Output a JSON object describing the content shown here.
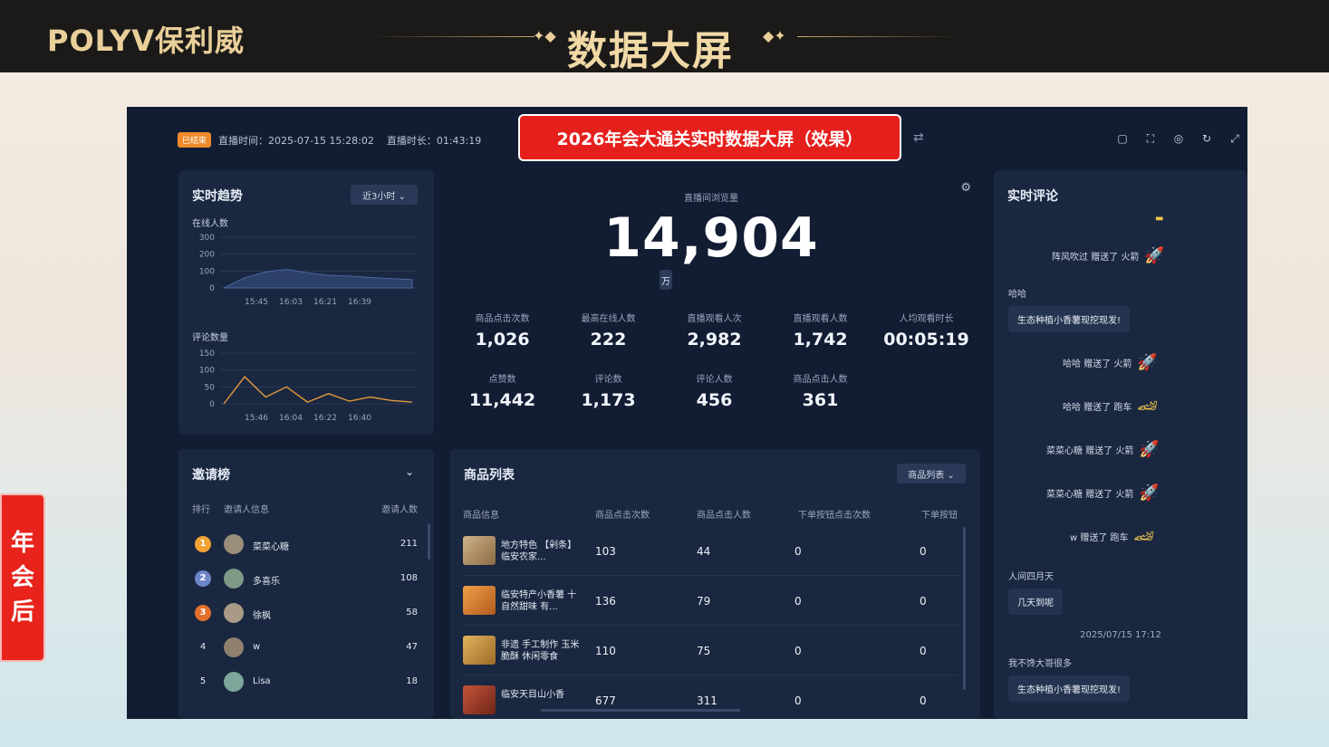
{
  "slide": {
    "brand": "POLYV保利威",
    "heading": "数据大屏",
    "side_tag": [
      "年",
      "会",
      "后"
    ]
  },
  "dashboard": {
    "live_badge": "已结束",
    "live_time": "直播时间：2025-07-15 15:28:02",
    "live_duration": "直播时长：01:43:19",
    "title": "2026年会大通关实时数据大屏（效果）",
    "icons": [
      "swap-icon",
      "window-icon",
      "fullscreen-icon",
      "help-icon",
      "refresh-icon",
      "expand-icon"
    ]
  },
  "trend": {
    "title": "实时趋势",
    "range": "近3小时 ⌄",
    "online_label": "在线人数",
    "online_y": [
      "300",
      "200",
      "100",
      "0"
    ],
    "online_x": [
      "15:45",
      "16:03",
      "16:21",
      "16:39"
    ],
    "comment_label": "评论数量",
    "comment_y": [
      "150",
      "100",
      "50",
      "0"
    ],
    "comment_x": [
      "15:46",
      "16:04",
      "16:22",
      "16:40"
    ]
  },
  "chart_data": [
    {
      "type": "area",
      "title": "在线人数",
      "x": [
        "15:45",
        "15:50",
        "15:55",
        "16:00",
        "16:03",
        "16:10",
        "16:21",
        "16:30",
        "16:39",
        "16:50"
      ],
      "values": [
        0,
        60,
        95,
        110,
        90,
        75,
        70,
        62,
        55,
        50
      ],
      "ylim": [
        0,
        300
      ]
    },
    {
      "type": "line",
      "title": "评论数量",
      "x": [
        "15:46",
        "15:50",
        "15:55",
        "16:00",
        "16:04",
        "16:10",
        "16:22",
        "16:30",
        "16:40",
        "16:50"
      ],
      "values": [
        0,
        80,
        20,
        50,
        5,
        30,
        8,
        20,
        10,
        5
      ],
      "ylim": [
        0,
        150
      ]
    }
  ],
  "stats": {
    "main_label": "直播间浏览量",
    "main_value": "14,904",
    "unit": "万",
    "items": [
      {
        "label": "商品点击次数",
        "value": "1,026"
      },
      {
        "label": "最高在线人数",
        "value": "222"
      },
      {
        "label": "直播观看人次",
        "value": "2,982"
      },
      {
        "label": "直播观看人数",
        "value": "1,742"
      },
      {
        "label": "人均观看时长",
        "value": "00:05:19"
      },
      {
        "label": "点赞数",
        "value": "11,442"
      },
      {
        "label": "评论数",
        "value": "1,173"
      },
      {
        "label": "评论人数",
        "value": "456"
      },
      {
        "label": "商品点击人数",
        "value": "361"
      }
    ]
  },
  "comments": {
    "title": "实时评论",
    "items": [
      {
        "kind": "gift",
        "text": "阵风吹过 赠送了 火箭",
        "icon": "rocket"
      },
      {
        "kind": "user",
        "text": "哈哈"
      },
      {
        "kind": "bubble",
        "text": "生态种植小香薯现挖现发!"
      },
      {
        "kind": "gift",
        "text": "哈哈 赠送了 火箭",
        "icon": "rocket"
      },
      {
        "kind": "gift",
        "text": "哈哈 赠送了 跑车",
        "icon": "car"
      },
      {
        "kind": "gift",
        "text": "菜菜心糖 赠送了 火箭",
        "icon": "rocket"
      },
      {
        "kind": "gift",
        "text": "菜菜心糖 赠送了 火箭",
        "icon": "rocket"
      },
      {
        "kind": "gift",
        "text": "w 赠送了 跑车",
        "icon": "car"
      },
      {
        "kind": "user",
        "text": "人间四月天"
      },
      {
        "kind": "bubble",
        "text": "几天到呢"
      },
      {
        "kind": "time",
        "text": "2025/07/15 17:12"
      },
      {
        "kind": "user",
        "text": "我不馋大哥很多"
      },
      {
        "kind": "bubble",
        "text": "生态种植小香薯现挖现发!"
      }
    ]
  },
  "invite": {
    "title": "邀请榜",
    "headers": [
      "排行",
      "邀请人信息",
      "邀请人数"
    ],
    "rows": [
      {
        "rank": "1",
        "name": "菜菜心糖",
        "count": "211"
      },
      {
        "rank": "2",
        "name": "多喜乐",
        "count": "108"
      },
      {
        "rank": "3",
        "name": "徐枫",
        "count": "58"
      },
      {
        "rank": "4",
        "name": "w",
        "count": "47"
      },
      {
        "rank": "5",
        "name": "Lisa",
        "count": "18"
      }
    ]
  },
  "products": {
    "title": "商品列表",
    "select": "商品列表 ⌄",
    "headers": [
      "商品信息",
      "商品点击次数",
      "商品点击人数",
      "下单按钮点击次数",
      "下单按钮"
    ],
    "rows": [
      {
        "name": "地方特色 【剁条】临安农家...",
        "clicks": "103",
        "users": "44",
        "order_clicks": "0",
        "orders": "0"
      },
      {
        "name": "临安特产小香薯 十 自然甜味 有...",
        "clicks": "136",
        "users": "79",
        "order_clicks": "0",
        "orders": "0"
      },
      {
        "name": "非遗 手工制作 玉米脆酥 休闲零食",
        "clicks": "110",
        "users": "75",
        "order_clicks": "0",
        "orders": "0"
      },
      {
        "name": "临安天目山小香",
        "clicks": "677",
        "users": "311",
        "order_clicks": "0",
        "orders": "0"
      }
    ]
  }
}
